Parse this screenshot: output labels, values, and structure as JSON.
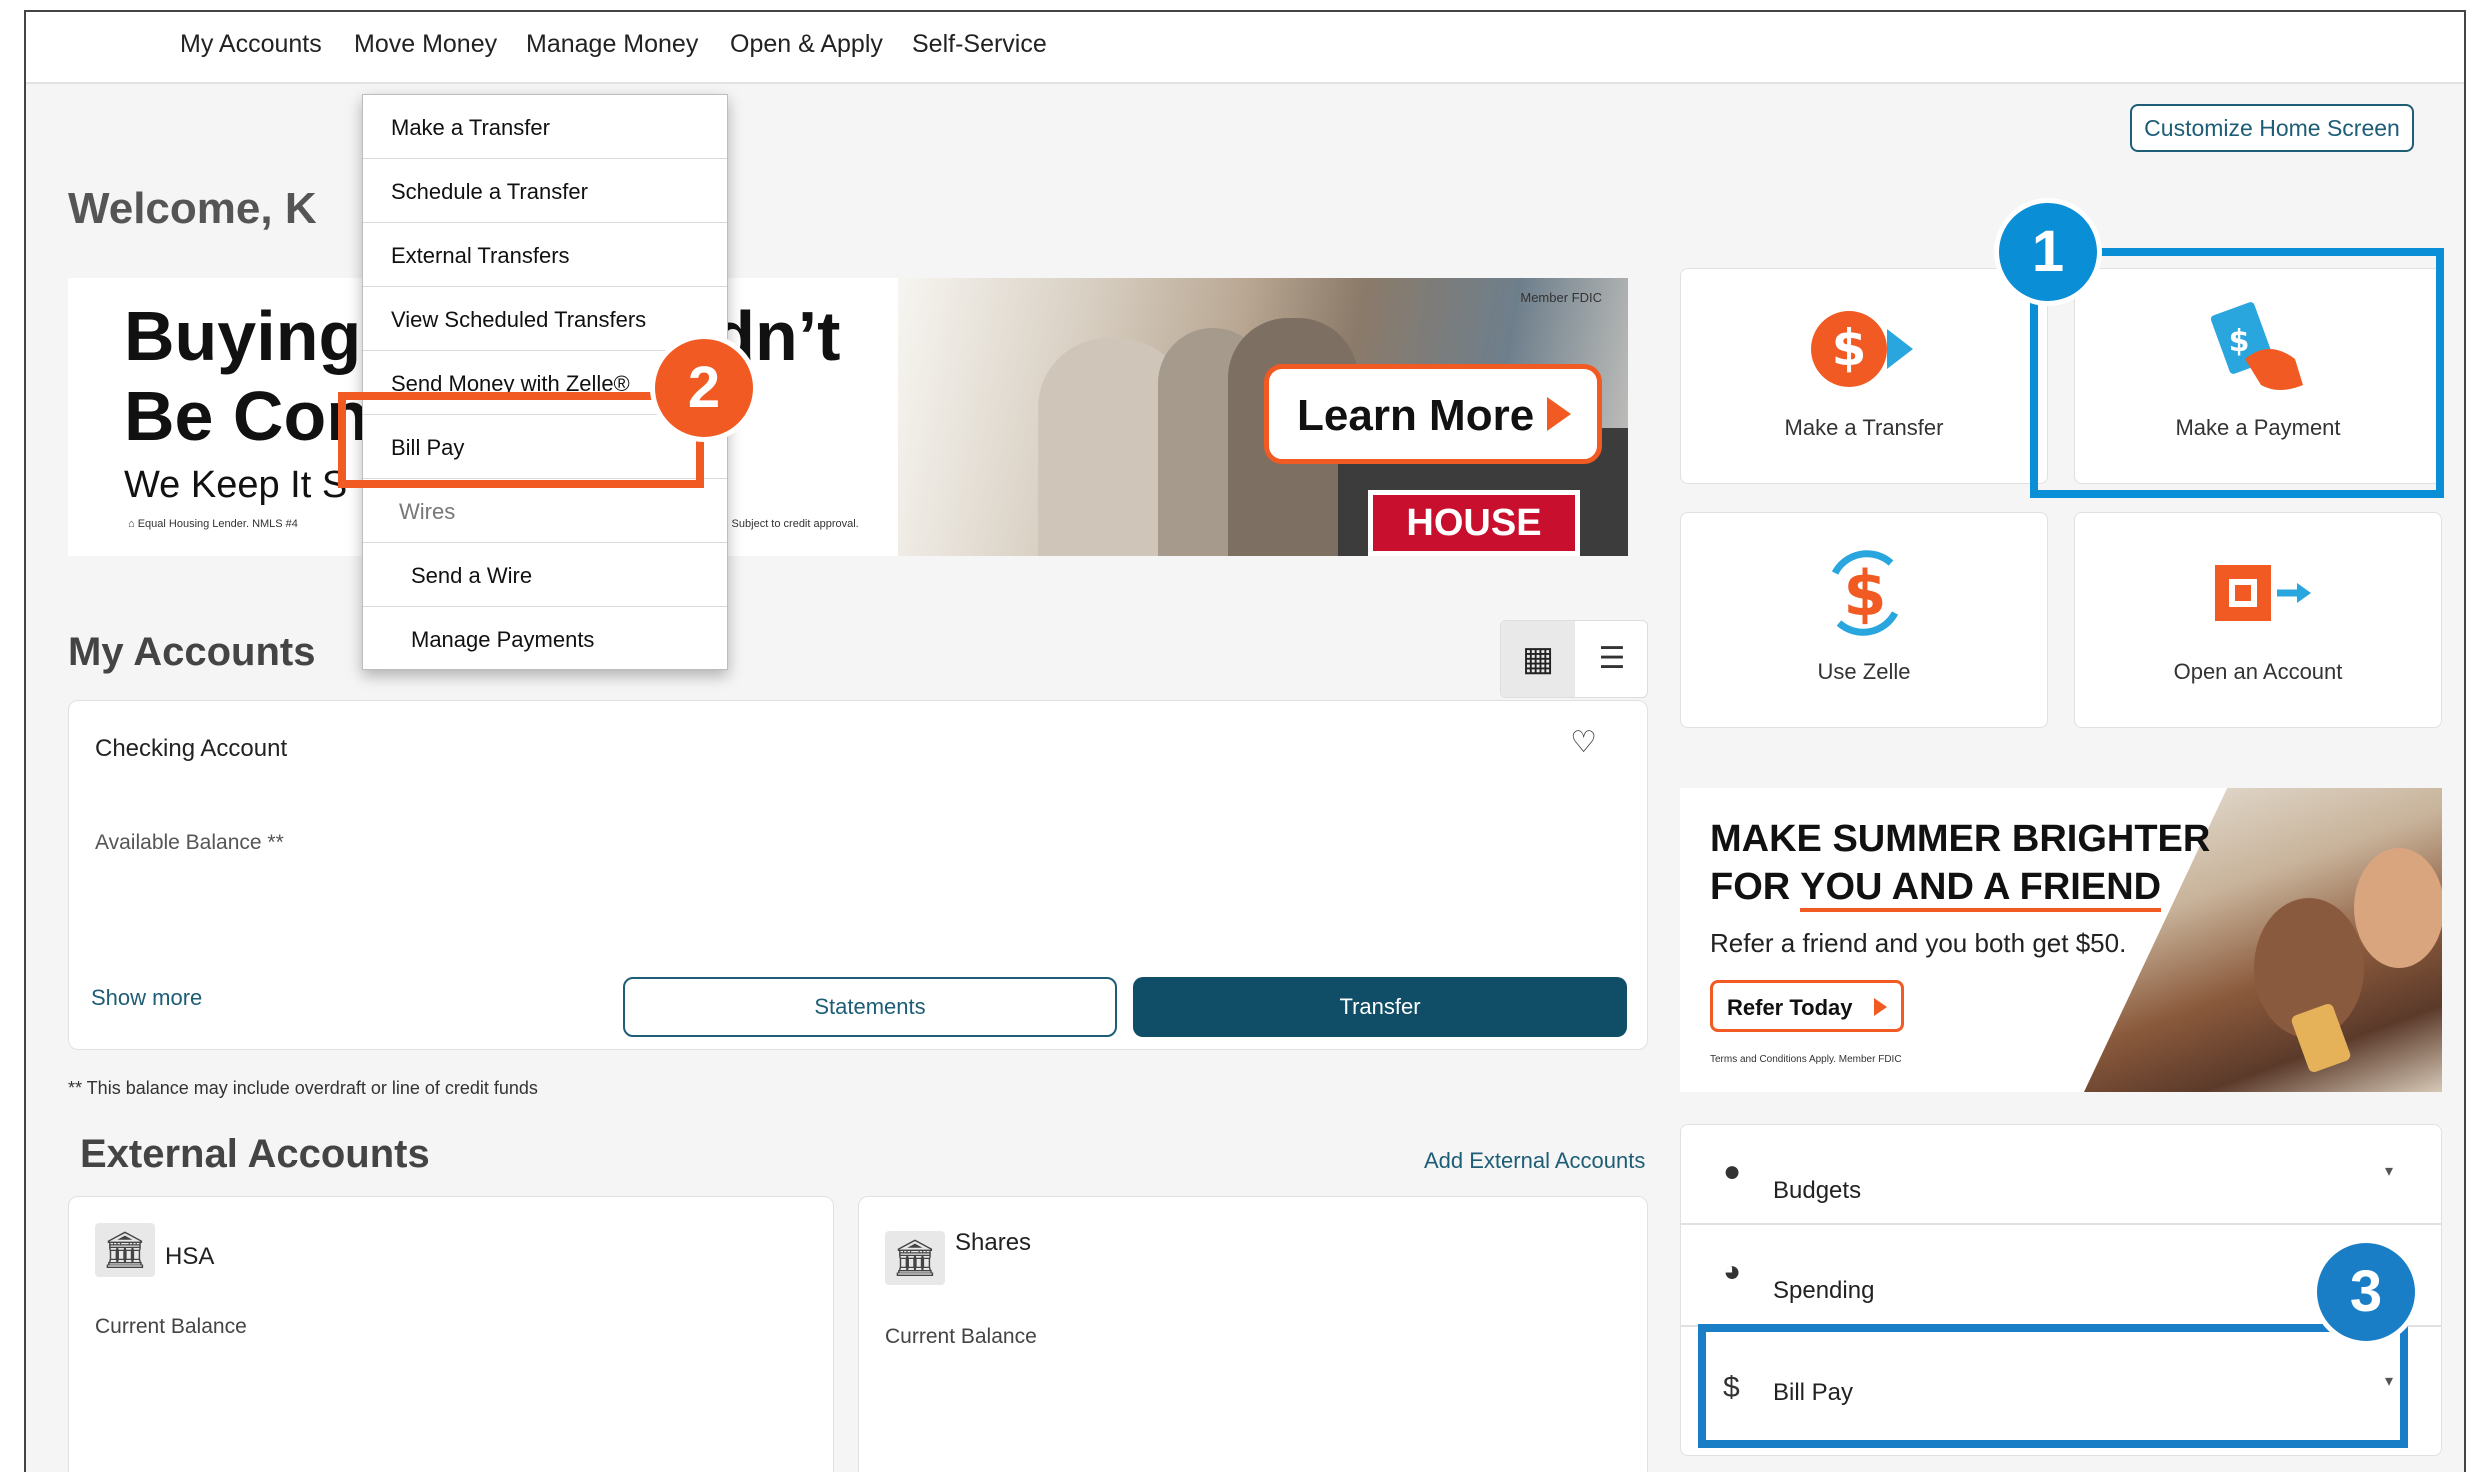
{
  "topnav": {
    "items": [
      "My Accounts",
      "Move Money",
      "Manage Money",
      "Open & Apply",
      "Self-Service"
    ]
  },
  "move_money_menu": {
    "items": [
      "Make a Transfer",
      "Schedule a Transfer",
      "External Transfers",
      "View Scheduled Transfers",
      "Send Money with Zelle®",
      "Bill Pay"
    ],
    "wires_label": "Wires",
    "wires_items": [
      "Send a Wire",
      "Manage Payments"
    ]
  },
  "header": {
    "customize_label": "Customize Home Screen",
    "welcome": "Welcome, K"
  },
  "home_banner": {
    "headline_1": "Buying",
    "headline_1_end": "uldn’t",
    "headline_2": "Be Con",
    "subline": "We Keep It S",
    "legal_left": "Equal Housing Lender. NMLS #4",
    "legal_right": "s Subject to credit approval.",
    "fdic": "Member FDIC",
    "learn_more": "Learn More",
    "sign_text": "HOUSE"
  },
  "my_accounts": {
    "title": "My Accounts",
    "checking": {
      "name": "Checking Account",
      "balance_label": "Available Balance **",
      "show_more": "Show more",
      "statements_label": "Statements",
      "transfer_label": "Transfer"
    },
    "footnote": "** This balance may include overdraft or line of credit funds"
  },
  "external_accounts": {
    "title": "External Accounts",
    "add_label": "Add External Accounts",
    "accounts": [
      {
        "name": "HSA",
        "balance_label": "Current Balance"
      },
      {
        "name": "Shares",
        "balance_label": "Current Balance"
      }
    ]
  },
  "quick_actions": [
    {
      "label": "Make a Transfer",
      "icon": "dollar-transfer-icon"
    },
    {
      "label": "Make a Payment",
      "icon": "hand-payment-icon"
    },
    {
      "label": "Use Zelle",
      "icon": "zelle-dollar-icon"
    },
    {
      "label": "Open an Account",
      "icon": "open-account-icon"
    }
  ],
  "promo": {
    "line1": "MAKE SUMMER BRIGHTER",
    "line2_prefix": "FOR ",
    "line2_underlined": "YOU AND A FRIEND",
    "sub": "Refer a friend and you both get $50.",
    "cta": "Refer Today",
    "legal": "Terms and Conditions Apply. Member FDIC"
  },
  "tools": [
    {
      "label": "Budgets",
      "icon": "bubbles-icon"
    },
    {
      "label": "Spending",
      "icon": "pie-chart-icon"
    },
    {
      "label": "Bill Pay",
      "icon": "dollar-icon"
    }
  ],
  "annotations": {
    "step1": "1",
    "step2": "2",
    "step3": "3",
    "blue": "#0a8fd6",
    "orange": "#f15a22",
    "blue_box": "#1a7ec7"
  },
  "colors": {
    "brand_teal": "#0f4e66",
    "accent_orange": "#f15a22"
  }
}
